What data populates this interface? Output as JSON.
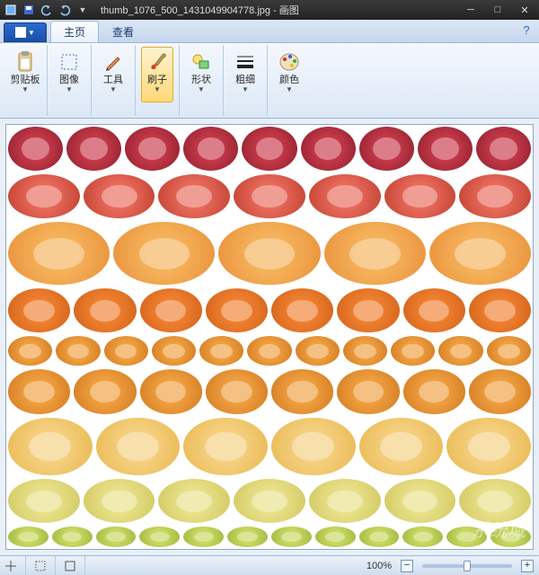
{
  "title": {
    "filename": "thumb_1076_500_1431049904778.jpg",
    "appname": "画图"
  },
  "tabs": {
    "home": "主页",
    "view": "查看"
  },
  "ribbon": {
    "clipboard": "剪贴板",
    "image": "图像",
    "tools": "工具",
    "brushes": "刷子",
    "shapes": "形状",
    "thickness": "粗细",
    "colors": "颜色"
  },
  "status": {
    "zoom_pct": "100%",
    "zoom_minus": "−",
    "zoom_plus": "+"
  },
  "icons": {
    "paste": "clipboard-icon",
    "select": "select-icon",
    "pencil": "pencil-icon",
    "brush": "brush-icon",
    "shapes": "shapes-icon",
    "lines": "lines-icon",
    "palette": "palette-icon"
  },
  "watermark": "系统域"
}
